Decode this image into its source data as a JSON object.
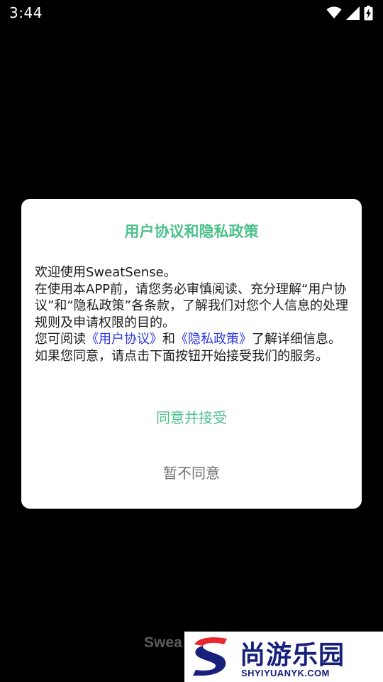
{
  "status_bar": {
    "time": "3:44",
    "icons": [
      "wifi-icon",
      "cellular-signal-icon",
      "battery-charging-icon"
    ]
  },
  "dialog": {
    "title": "用户协议和隐私政策",
    "body": {
      "line1": "欢迎使用SweatSense。",
      "paragraph2": "在使用本APP前，请您务必审慎阅读、充分理解“用户协议”和“隐私政策”各条款，了解我们对您个人信息的处理规则及申请权限的目的。",
      "p3_prefix": "您可阅读",
      "user_agreement_link": "《用户协议》",
      "p3_and": "和",
      "privacy_policy_link": "《隐私政策》",
      "p3_suffix": "了解详细信息。如果您同意，请点击下面按钮开始接受我们的服务。"
    },
    "accept_label": "同意并接受",
    "decline_label": "暂不同意"
  },
  "background": {
    "app_name_partial": "Swea"
  },
  "watermark": {
    "name": "尚游乐园",
    "url": "SHYIYUANYK.COM"
  },
  "colors": {
    "accent_green": "#4cc08b",
    "link_blue": "#2a36e0",
    "watermark_navy": "#17207a",
    "watermark_red": "#e8262d"
  }
}
